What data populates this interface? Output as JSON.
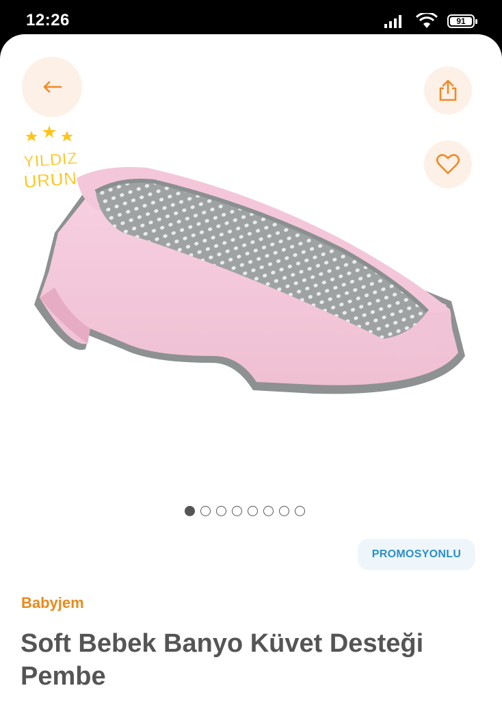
{
  "status_bar": {
    "time": "12:26",
    "battery": "91",
    "icons": [
      "signal-icon",
      "wifi-icon",
      "battery-icon"
    ]
  },
  "header": {
    "back_icon": "back-arrow-icon",
    "share_icon": "share-icon",
    "favorite_icon": "heart-icon",
    "accent_color": "#f08a24",
    "button_bg": "#fdf0e6"
  },
  "badge": {
    "line1": "YILDIZ",
    "line2": "ÜRÜN",
    "color": "#ffc31a"
  },
  "gallery": {
    "image_count": 8,
    "active_index": 0,
    "image": "pink-baby-bath-support-seat"
  },
  "promo_label": "PROMOSYONLU",
  "product": {
    "brand": "Babyjem",
    "title": "Soft Bebek Banyo Küvet Desteği Pembe"
  }
}
